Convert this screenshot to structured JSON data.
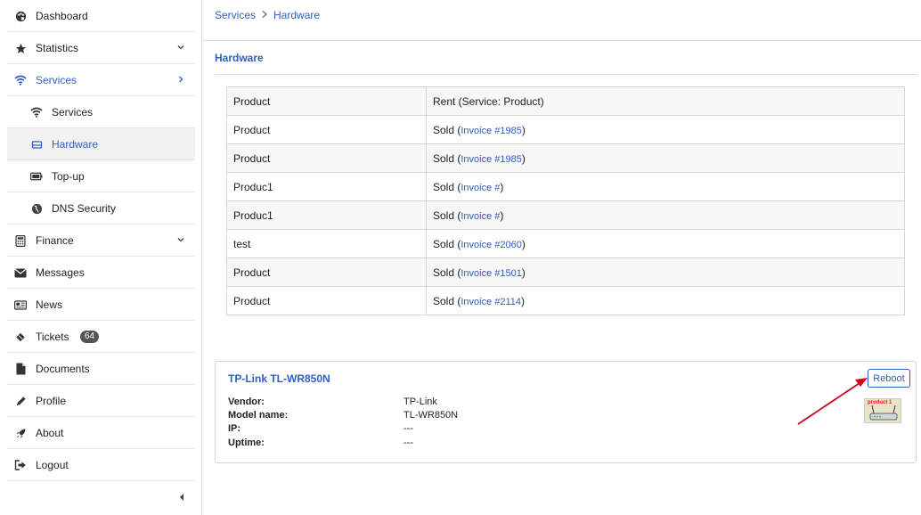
{
  "sidebar": {
    "items": [
      {
        "label": "Dashboard",
        "icon": "palette-icon"
      },
      {
        "label": "Statistics",
        "icon": "star-icon"
      },
      {
        "label": "Services",
        "icon": "wifi-icon"
      },
      {
        "label": "Services",
        "icon": "wifi-icon"
      },
      {
        "label": "Hardware",
        "icon": "router-icon"
      },
      {
        "label": "Top-up",
        "icon": "battery-icon"
      },
      {
        "label": "DNS Security",
        "icon": "globe-icon"
      },
      {
        "label": "Finance",
        "icon": "calculator-icon"
      },
      {
        "label": "Messages",
        "icon": "envelope-icon"
      },
      {
        "label": "News",
        "icon": "newspaper-icon"
      },
      {
        "label": "Tickets",
        "icon": "ticket-icon",
        "badge": "64"
      },
      {
        "label": "Documents",
        "icon": "file-icon"
      },
      {
        "label": "Profile",
        "icon": "pencil-icon"
      },
      {
        "label": "About",
        "icon": "rocket-icon"
      },
      {
        "label": "Logout",
        "icon": "logout-icon"
      }
    ]
  },
  "breadcrumb": {
    "parent": "Services",
    "current": "Hardware"
  },
  "section": {
    "title": "Hardware"
  },
  "table": {
    "rows": [
      {
        "product": "Product",
        "status": "Rent (Service: Product)",
        "link": ""
      },
      {
        "product": "Product",
        "status": "Sold (",
        "link": "Invoice #1985",
        "close": ")"
      },
      {
        "product": "Product",
        "status": "Sold (",
        "link": "Invoice #1985",
        "close": ")"
      },
      {
        "product": "Produc1",
        "status": "Sold (",
        "link": "Invoice #",
        "close": ")"
      },
      {
        "product": "Produc1",
        "status": "Sold (",
        "link": "Invoice #",
        "close": ")"
      },
      {
        "product": "test",
        "status": "Sold (",
        "link": "Invoice #2060",
        "close": ")"
      },
      {
        "product": "Product",
        "status": "Sold (",
        "link": "Invoice #1501",
        "close": ")"
      },
      {
        "product": "Product",
        "status": "Sold (",
        "link": "Invoice #2114",
        "close": ")"
      }
    ]
  },
  "device": {
    "title": "TP-Link TL-WR850N",
    "reboot_label": "Reboot",
    "image_label": "product 1",
    "specs": [
      {
        "label": "Vendor:",
        "value": "TP-Link"
      },
      {
        "label": "Model name:",
        "value": "TL-WR850N"
      },
      {
        "label": "IP:",
        "value": "---"
      },
      {
        "label": "Uptime:",
        "value": "---"
      }
    ]
  },
  "colors": {
    "accent": "#2f5fc1",
    "annotation_arrow": "#d0021b"
  }
}
